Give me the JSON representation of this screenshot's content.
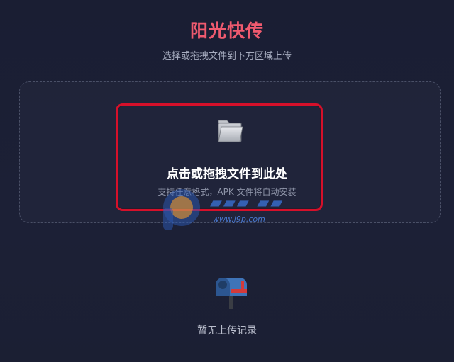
{
  "header": {
    "title": "阳光快传",
    "subtitle": "选择或拖拽文件到下方区域上传"
  },
  "drop_zone": {
    "icon": "folder-icon",
    "title": "点击或拖拽文件到此处",
    "hint": "支持任意格式，APK 文件将自动安装"
  },
  "watermark": {
    "url": "www.j9p.com"
  },
  "history": {
    "icon": "mailbox-icon",
    "empty_text": "暂无上传记录"
  },
  "colors": {
    "accent": "#ef5a6f",
    "background": "#1b1f35",
    "highlight": "#d6102a"
  }
}
